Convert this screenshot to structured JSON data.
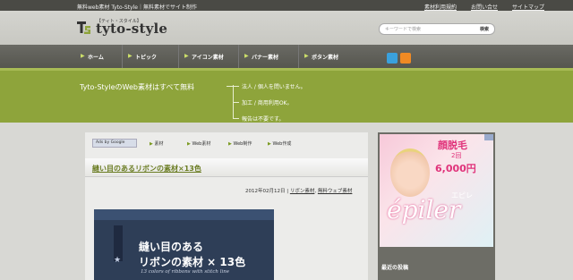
{
  "topbar": {
    "tagline": "無料web素材 Tyto-Style｜無料素材でサイト制作",
    "links": [
      "素材利用規約",
      "お問い合せ",
      "サイトマップ"
    ]
  },
  "logo": {
    "subtitle": "【ティト・スタイル】",
    "name": "tyto-style"
  },
  "search": {
    "placeholder": "キーワードで検索",
    "button": "検索"
  },
  "nav": {
    "items": [
      "ホーム",
      "トピック",
      "アイコン素材",
      "バナー素材",
      "ボタン素材"
    ]
  },
  "banner": {
    "title": "Tyto-StyleのWeb素材はすべて無料",
    "points": [
      "法人 / 個人を問いません。",
      "加工 / 商用利用OK。",
      "報告は不要です。"
    ]
  },
  "adbar": {
    "ads_label": "Ads by Google",
    "links": [
      "素材",
      "Web素材",
      "Web制作",
      "Web作成"
    ]
  },
  "post": {
    "title": "縫い目のあるリボンの素材×13色",
    "date": "2012年02月12日",
    "categories": [
      "リボン素材",
      "無料ウェブ素材"
    ],
    "thumbnail": {
      "line1": "縫い目のある",
      "line2": "リボンの素材 × 13色",
      "line3": "13 colors of ribbons with stitch line"
    }
  },
  "sidebar": {
    "ad": {
      "headline": "顔脱毛",
      "count": "2回",
      "price": "6,000円",
      "kana": "エピレ",
      "brand": "épiler"
    },
    "section_title": "最近の投稿"
  },
  "colors": {
    "accent_green": "#8ea43b",
    "nav_bg": "#5e5e58",
    "link_green": "#6a7c22"
  }
}
